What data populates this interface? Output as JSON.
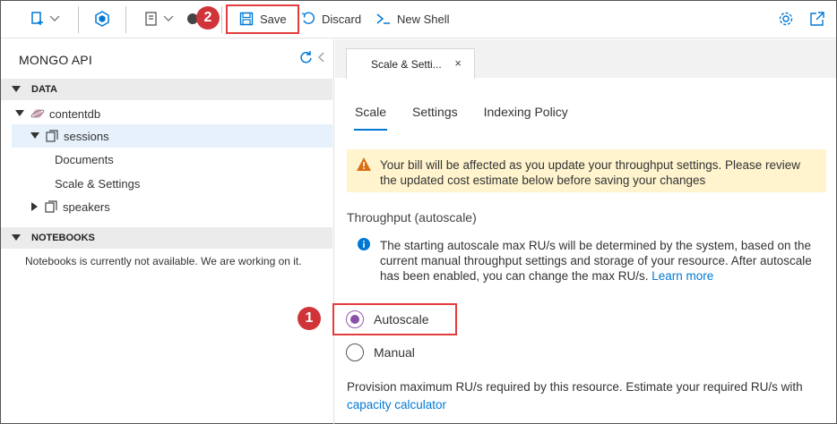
{
  "toolbar": {
    "save_label": "Save",
    "discard_label": "Discard",
    "new_shell_label": "New Shell"
  },
  "callouts": {
    "one": "1",
    "two": "2"
  },
  "left": {
    "header": "MONGO API",
    "data_section": "DATA",
    "database": "contentdb",
    "collection": "sessions",
    "documents": "Documents",
    "scale_settings": "Scale & Settings",
    "speakers": "speakers",
    "notebooks_section": "NOTEBOOKS",
    "notebooks_notice": "Notebooks is currently not available. We are working on it."
  },
  "right": {
    "tab_label": "Scale & Setti...",
    "tab_close": "×",
    "subtabs": [
      "Scale",
      "Settings",
      "Indexing Policy"
    ],
    "warning": "Your bill will be affected as you update your throughput settings. Please review the updated cost estimate below before saving your changes",
    "throughput_label": "Throughput (autoscale)",
    "info_text": "The starting autoscale max RU/s will be determined by the system, based on the current manual throughput settings and storage of your resource. After autoscale has been enabled, you can change the max RU/s.",
    "learn_more": "Learn more",
    "autoscale_label": "Autoscale",
    "manual_label": "Manual",
    "provision_text": "Provision maximum RU/s required by this resource. Estimate your required RU/s with",
    "capacity_link": "capacity calculator"
  },
  "colors": {
    "accent": "#0078d4",
    "callout": "#d13438",
    "highlight_box": "#e33c3c",
    "warning_bg": "#fff4ce",
    "radio_selected": "#8a4fa8"
  },
  "icons": [
    "new-collection-icon",
    "mongo-shell-icon",
    "new-notebook-icon",
    "save-icon",
    "discard-icon",
    "terminal-icon",
    "settings-icon",
    "open-external-icon",
    "refresh-icon",
    "collapse-icon",
    "warning-icon",
    "info-icon"
  ]
}
